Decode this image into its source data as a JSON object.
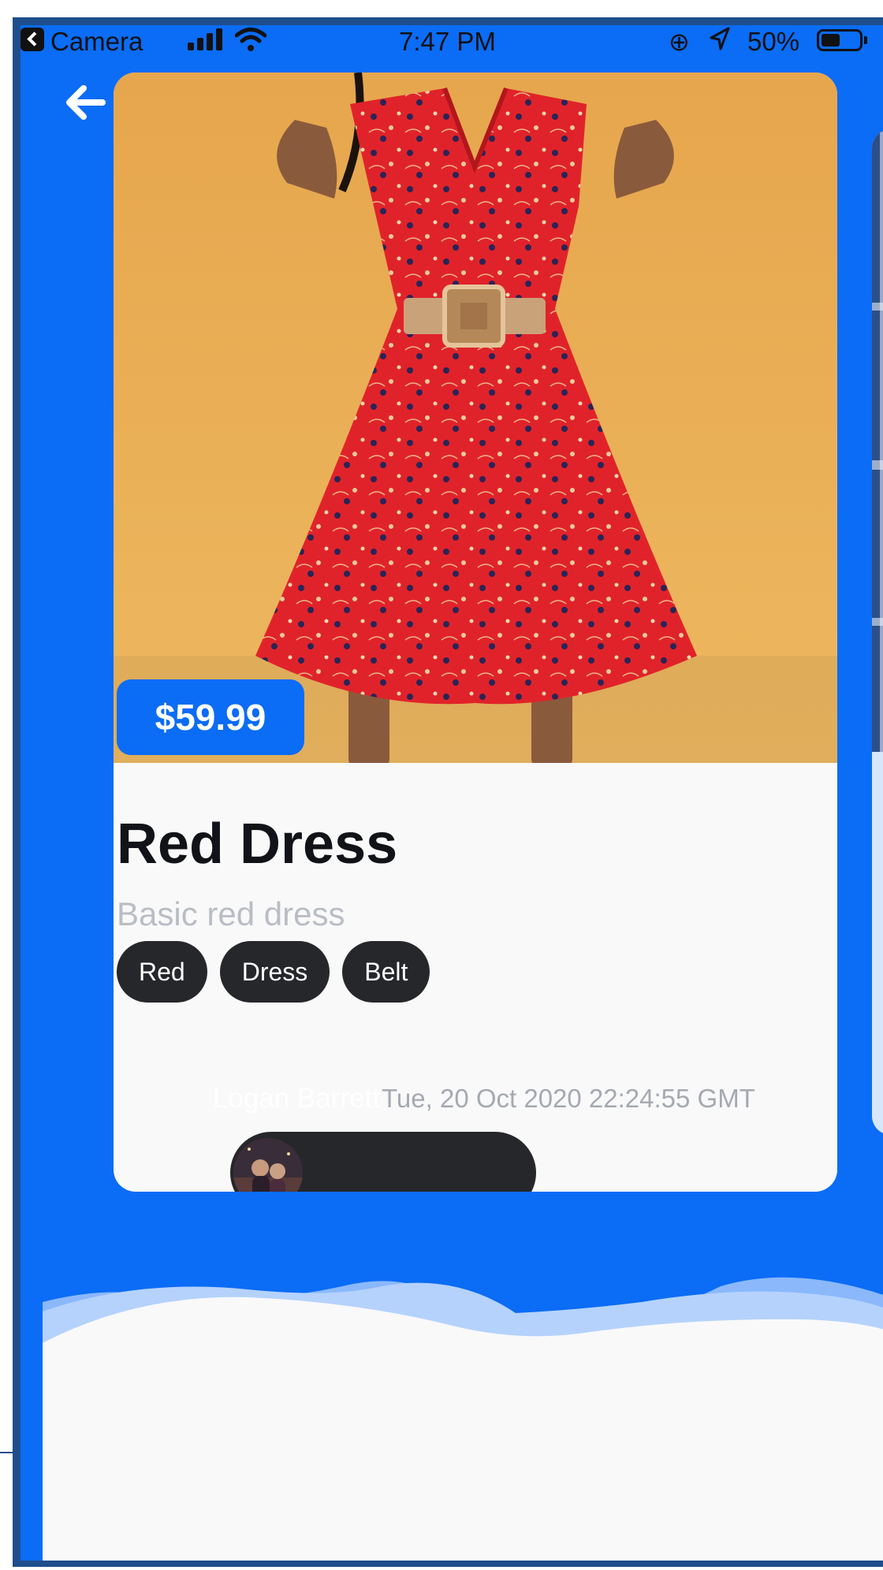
{
  "status_bar": {
    "carrier": "Camera",
    "time": "7:47 PM",
    "battery": "50%",
    "battery_level": 0.5
  },
  "product": {
    "price": "$59.99",
    "title": "Red Dress",
    "subtitle": "Basic red dress",
    "tags": [
      "Red",
      "Dress",
      "Belt"
    ],
    "author": "Logan Barrett",
    "timestamp": "Tue, 20 Oct 2020 22:24:55 GMT"
  },
  "icons": {
    "back": "arrow-left-icon",
    "signal": "cellular-signal-icon",
    "wifi": "wifi-icon",
    "orientation_lock": "orientation-lock-icon",
    "location": "location-arrow-icon",
    "battery": "battery-icon"
  },
  "colors": {
    "accent": "#0b6cf5",
    "chip": "#26272b",
    "card": "#f9f9fa",
    "photo_background": "#e9ab54",
    "dress": "#e3242b"
  }
}
